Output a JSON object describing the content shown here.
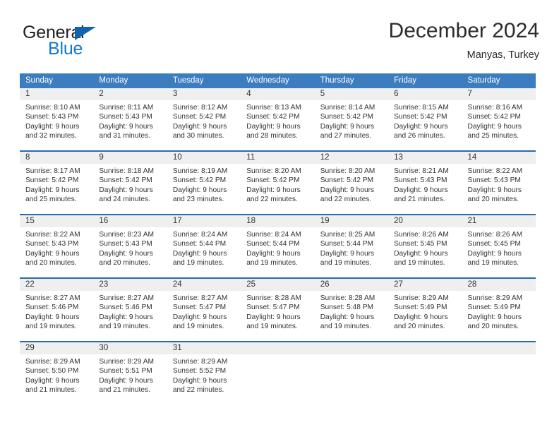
{
  "brand": {
    "name_part1": "General",
    "name_part2": "Blue",
    "triangle_color": "#1263ad",
    "blue_color": "#1279cc"
  },
  "header": {
    "title": "December 2024",
    "subtitle": "Manyas, Turkey"
  },
  "theme": {
    "header_blue": "#3b7dbf",
    "rule_blue": "#2a6cab",
    "daynum_band": "#efefef"
  },
  "weekdays": [
    "Sunday",
    "Monday",
    "Tuesday",
    "Wednesday",
    "Thursday",
    "Friday",
    "Saturday"
  ],
  "weeks": [
    [
      {
        "day": "1",
        "sunrise": "Sunrise: 8:10 AM",
        "sunset": "Sunset: 5:43 PM",
        "daylight1": "Daylight: 9 hours",
        "daylight2": "and 32 minutes."
      },
      {
        "day": "2",
        "sunrise": "Sunrise: 8:11 AM",
        "sunset": "Sunset: 5:43 PM",
        "daylight1": "Daylight: 9 hours",
        "daylight2": "and 31 minutes."
      },
      {
        "day": "3",
        "sunrise": "Sunrise: 8:12 AM",
        "sunset": "Sunset: 5:42 PM",
        "daylight1": "Daylight: 9 hours",
        "daylight2": "and 30 minutes."
      },
      {
        "day": "4",
        "sunrise": "Sunrise: 8:13 AM",
        "sunset": "Sunset: 5:42 PM",
        "daylight1": "Daylight: 9 hours",
        "daylight2": "and 28 minutes."
      },
      {
        "day": "5",
        "sunrise": "Sunrise: 8:14 AM",
        "sunset": "Sunset: 5:42 PM",
        "daylight1": "Daylight: 9 hours",
        "daylight2": "and 27 minutes."
      },
      {
        "day": "6",
        "sunrise": "Sunrise: 8:15 AM",
        "sunset": "Sunset: 5:42 PM",
        "daylight1": "Daylight: 9 hours",
        "daylight2": "and 26 minutes."
      },
      {
        "day": "7",
        "sunrise": "Sunrise: 8:16 AM",
        "sunset": "Sunset: 5:42 PM",
        "daylight1": "Daylight: 9 hours",
        "daylight2": "and 25 minutes."
      }
    ],
    [
      {
        "day": "8",
        "sunrise": "Sunrise: 8:17 AM",
        "sunset": "Sunset: 5:42 PM",
        "daylight1": "Daylight: 9 hours",
        "daylight2": "and 25 minutes."
      },
      {
        "day": "9",
        "sunrise": "Sunrise: 8:18 AM",
        "sunset": "Sunset: 5:42 PM",
        "daylight1": "Daylight: 9 hours",
        "daylight2": "and 24 minutes."
      },
      {
        "day": "10",
        "sunrise": "Sunrise: 8:19 AM",
        "sunset": "Sunset: 5:42 PM",
        "daylight1": "Daylight: 9 hours",
        "daylight2": "and 23 minutes."
      },
      {
        "day": "11",
        "sunrise": "Sunrise: 8:20 AM",
        "sunset": "Sunset: 5:42 PM",
        "daylight1": "Daylight: 9 hours",
        "daylight2": "and 22 minutes."
      },
      {
        "day": "12",
        "sunrise": "Sunrise: 8:20 AM",
        "sunset": "Sunset: 5:42 PM",
        "daylight1": "Daylight: 9 hours",
        "daylight2": "and 22 minutes."
      },
      {
        "day": "13",
        "sunrise": "Sunrise: 8:21 AM",
        "sunset": "Sunset: 5:43 PM",
        "daylight1": "Daylight: 9 hours",
        "daylight2": "and 21 minutes."
      },
      {
        "day": "14",
        "sunrise": "Sunrise: 8:22 AM",
        "sunset": "Sunset: 5:43 PM",
        "daylight1": "Daylight: 9 hours",
        "daylight2": "and 20 minutes."
      }
    ],
    [
      {
        "day": "15",
        "sunrise": "Sunrise: 8:22 AM",
        "sunset": "Sunset: 5:43 PM",
        "daylight1": "Daylight: 9 hours",
        "daylight2": "and 20 minutes."
      },
      {
        "day": "16",
        "sunrise": "Sunrise: 8:23 AM",
        "sunset": "Sunset: 5:43 PM",
        "daylight1": "Daylight: 9 hours",
        "daylight2": "and 20 minutes."
      },
      {
        "day": "17",
        "sunrise": "Sunrise: 8:24 AM",
        "sunset": "Sunset: 5:44 PM",
        "daylight1": "Daylight: 9 hours",
        "daylight2": "and 19 minutes."
      },
      {
        "day": "18",
        "sunrise": "Sunrise: 8:24 AM",
        "sunset": "Sunset: 5:44 PM",
        "daylight1": "Daylight: 9 hours",
        "daylight2": "and 19 minutes."
      },
      {
        "day": "19",
        "sunrise": "Sunrise: 8:25 AM",
        "sunset": "Sunset: 5:44 PM",
        "daylight1": "Daylight: 9 hours",
        "daylight2": "and 19 minutes."
      },
      {
        "day": "20",
        "sunrise": "Sunrise: 8:26 AM",
        "sunset": "Sunset: 5:45 PM",
        "daylight1": "Daylight: 9 hours",
        "daylight2": "and 19 minutes."
      },
      {
        "day": "21",
        "sunrise": "Sunrise: 8:26 AM",
        "sunset": "Sunset: 5:45 PM",
        "daylight1": "Daylight: 9 hours",
        "daylight2": "and 19 minutes."
      }
    ],
    [
      {
        "day": "22",
        "sunrise": "Sunrise: 8:27 AM",
        "sunset": "Sunset: 5:46 PM",
        "daylight1": "Daylight: 9 hours",
        "daylight2": "and 19 minutes."
      },
      {
        "day": "23",
        "sunrise": "Sunrise: 8:27 AM",
        "sunset": "Sunset: 5:46 PM",
        "daylight1": "Daylight: 9 hours",
        "daylight2": "and 19 minutes."
      },
      {
        "day": "24",
        "sunrise": "Sunrise: 8:27 AM",
        "sunset": "Sunset: 5:47 PM",
        "daylight1": "Daylight: 9 hours",
        "daylight2": "and 19 minutes."
      },
      {
        "day": "25",
        "sunrise": "Sunrise: 8:28 AM",
        "sunset": "Sunset: 5:47 PM",
        "daylight1": "Daylight: 9 hours",
        "daylight2": "and 19 minutes."
      },
      {
        "day": "26",
        "sunrise": "Sunrise: 8:28 AM",
        "sunset": "Sunset: 5:48 PM",
        "daylight1": "Daylight: 9 hours",
        "daylight2": "and 19 minutes."
      },
      {
        "day": "27",
        "sunrise": "Sunrise: 8:29 AM",
        "sunset": "Sunset: 5:49 PM",
        "daylight1": "Daylight: 9 hours",
        "daylight2": "and 20 minutes."
      },
      {
        "day": "28",
        "sunrise": "Sunrise: 8:29 AM",
        "sunset": "Sunset: 5:49 PM",
        "daylight1": "Daylight: 9 hours",
        "daylight2": "and 20 minutes."
      }
    ],
    [
      {
        "day": "29",
        "sunrise": "Sunrise: 8:29 AM",
        "sunset": "Sunset: 5:50 PM",
        "daylight1": "Daylight: 9 hours",
        "daylight2": "and 21 minutes."
      },
      {
        "day": "30",
        "sunrise": "Sunrise: 8:29 AM",
        "sunset": "Sunset: 5:51 PM",
        "daylight1": "Daylight: 9 hours",
        "daylight2": "and 21 minutes."
      },
      {
        "day": "31",
        "sunrise": "Sunrise: 8:29 AM",
        "sunset": "Sunset: 5:52 PM",
        "daylight1": "Daylight: 9 hours",
        "daylight2": "and 22 minutes."
      },
      {
        "day": "",
        "sunrise": "",
        "sunset": "",
        "daylight1": "",
        "daylight2": ""
      },
      {
        "day": "",
        "sunrise": "",
        "sunset": "",
        "daylight1": "",
        "daylight2": ""
      },
      {
        "day": "",
        "sunrise": "",
        "sunset": "",
        "daylight1": "",
        "daylight2": ""
      },
      {
        "day": "",
        "sunrise": "",
        "sunset": "",
        "daylight1": "",
        "daylight2": ""
      }
    ]
  ]
}
